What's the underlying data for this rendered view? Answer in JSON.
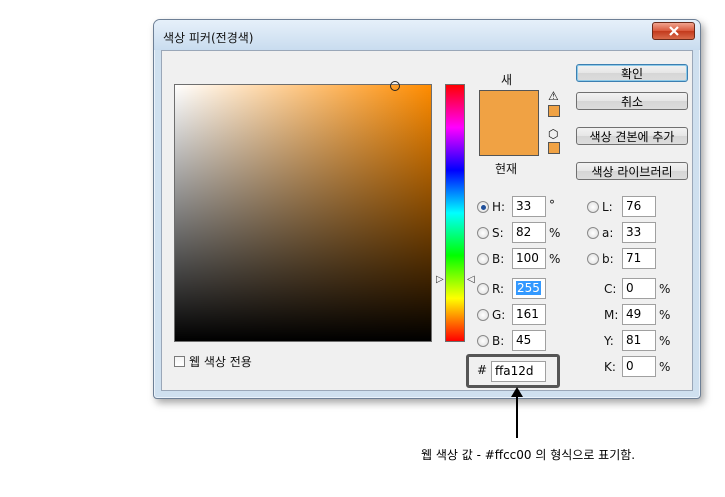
{
  "window": {
    "title": "색상 피커(전경색)"
  },
  "swatch": {
    "new_label": "새",
    "current_label": "현재",
    "color": "#f0a244"
  },
  "buttons": {
    "ok": "확인",
    "cancel": "취소",
    "add_to_swatches": "색상 견본에 추가",
    "color_libraries": "색상 라이브러리"
  },
  "web_colors": {
    "label": "웹 색상 전용"
  },
  "hsb": [
    {
      "label": "H:",
      "value": "33",
      "unit": "°",
      "selected": true
    },
    {
      "label": "S:",
      "value": "82",
      "unit": "%"
    },
    {
      "label": "B:",
      "value": "100",
      "unit": "%"
    }
  ],
  "lab": [
    {
      "label": "L:",
      "value": "76"
    },
    {
      "label": "a:",
      "value": "33"
    },
    {
      "label": "b:",
      "value": "71"
    }
  ],
  "rgb": [
    {
      "label": "R:",
      "value": "255"
    },
    {
      "label": "G:",
      "value": "161"
    },
    {
      "label": "B:",
      "value": "45"
    }
  ],
  "cmyk": [
    {
      "label": "C:",
      "value": "0",
      "unit": "%"
    },
    {
      "label": "M:",
      "value": "49",
      "unit": "%"
    },
    {
      "label": "Y:",
      "value": "81",
      "unit": "%"
    },
    {
      "label": "K:",
      "value": "0",
      "unit": "%"
    }
  ],
  "hex": {
    "symbol": "#",
    "value": "ffa12d"
  },
  "annotation": {
    "text": "웹 색상 값 - #ffcc00 의 형식으로 표기함."
  },
  "icons": {
    "warning": "warning-icon",
    "web_safe": "cube-icon",
    "close": "close-icon"
  }
}
